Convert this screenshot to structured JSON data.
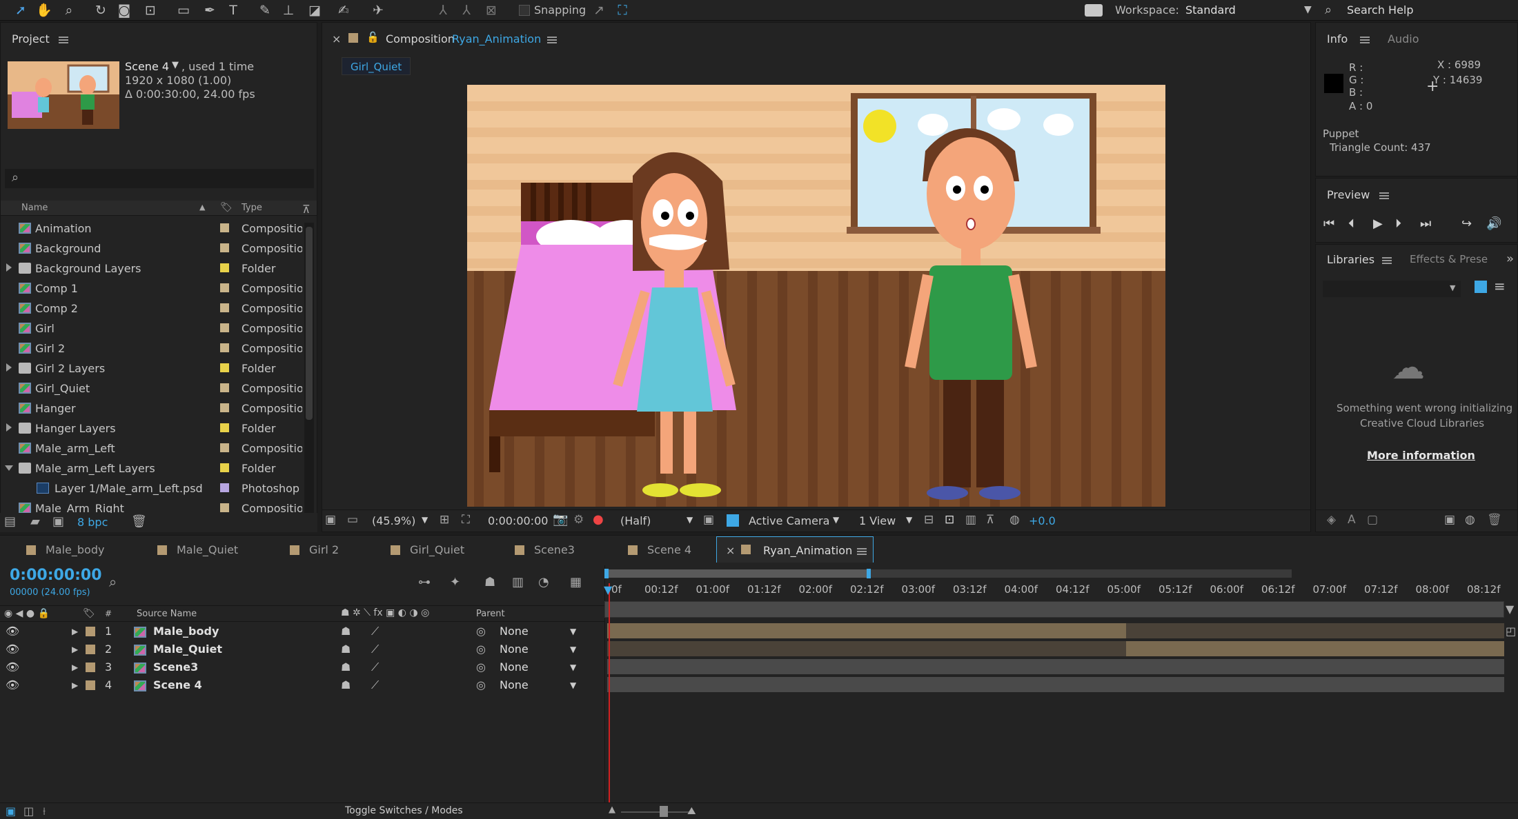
{
  "toolbar": {
    "snapping_label": "Snapping",
    "workspace_label": "Workspace:",
    "workspace_value": "Standard",
    "search_help": "Search Help"
  },
  "project": {
    "title": "Project",
    "selected_name": "Scene 4",
    "used": ", used 1 time",
    "dims": "1920 x 1080 (1.00)",
    "duration": "Δ 0:00:30:00, 24.00 fps",
    "col_name": "Name",
    "col_type": "Type",
    "items": [
      {
        "name": "Animation",
        "type": "Compositior",
        "kind": "comp",
        "label_color": "#c9b48a"
      },
      {
        "name": "Background",
        "type": "Compositior",
        "kind": "comp",
        "label_color": "#c9b48a"
      },
      {
        "name": "Background Layers",
        "type": "Folder",
        "kind": "folder",
        "label_color": "#e8d24a"
      },
      {
        "name": "Comp 1",
        "type": "Compositior",
        "kind": "comp",
        "label_color": "#c9b48a"
      },
      {
        "name": "Comp 2",
        "type": "Compositior",
        "kind": "comp",
        "label_color": "#c9b48a"
      },
      {
        "name": "Girl",
        "type": "Compositior",
        "kind": "comp",
        "label_color": "#c9b48a"
      },
      {
        "name": "Girl 2",
        "type": "Compositior",
        "kind": "comp",
        "label_color": "#c9b48a"
      },
      {
        "name": "Girl 2 Layers",
        "type": "Folder",
        "kind": "folder",
        "label_color": "#e8d24a"
      },
      {
        "name": "Girl_Quiet",
        "type": "Compositior",
        "kind": "comp",
        "label_color": "#c9b48a"
      },
      {
        "name": "Hanger",
        "type": "Compositior",
        "kind": "comp",
        "label_color": "#c9b48a"
      },
      {
        "name": "Hanger Layers",
        "type": "Folder",
        "kind": "folder",
        "label_color": "#e8d24a"
      },
      {
        "name": "Male_arm_Left",
        "type": "Compositior",
        "kind": "comp",
        "label_color": "#c9b48a"
      },
      {
        "name": "Male_arm_Left Layers",
        "type": "Folder",
        "kind": "folder",
        "label_color": "#e8d24a"
      },
      {
        "name": "Layer 1/Male_arm_Left.psd",
        "type": "Photoshop",
        "kind": "psd",
        "label_color": "#b7a6e0"
      },
      {
        "name": "Male_Arm_Right",
        "type": "Compositior",
        "kind": "comp",
        "label_color": "#c9b48a"
      }
    ],
    "bpc": "8 bpc"
  },
  "composition": {
    "panel_label": "Composition",
    "comp_name": "Ryan_Animation",
    "breadcrumb": "Girl_Quiet",
    "zoom": "(45.9%)",
    "timecode": "0:00:00:00",
    "resolution": "(Half)",
    "camera": "Active Camera",
    "views": "1 View",
    "exposure": "+0.0"
  },
  "info": {
    "tab_info": "Info",
    "tab_audio": "Audio",
    "r": "R :",
    "g": "G :",
    "b": "B :",
    "a": "A : 0",
    "x": "X : 6989",
    "y": "Y : 14639",
    "puppet": "Puppet",
    "triangle_count": "Triangle Count: 437"
  },
  "preview": {
    "title": "Preview"
  },
  "libraries": {
    "tab_libraries": "Libraries",
    "tab_effects": "Effects & Prese",
    "error_line1": "Something went wrong initializing",
    "error_line2": "Creative Cloud Libraries",
    "more_info": "More information"
  },
  "timeline": {
    "tabs": [
      "Male_body",
      "Male_Quiet",
      "Girl 2",
      "Girl_Quiet",
      "Scene3",
      "Scene 4",
      "Ryan_Animation"
    ],
    "timecode": "0:00:00:00",
    "frames": "00000 (24.00 fps)",
    "col_source": "Source Name",
    "col_parent": "Parent",
    "ruler": [
      "0f",
      "00:12f",
      "01:00f",
      "01:12f",
      "02:00f",
      "02:12f",
      "03:00f",
      "03:12f",
      "04:00f",
      "04:12f",
      "05:00f",
      "05:12f",
      "06:00f",
      "06:12f",
      "07:00f",
      "07:12f",
      "08:00f",
      "08:12f"
    ],
    "layers": [
      {
        "num": "1",
        "name": "Male_body",
        "parent": "None"
      },
      {
        "num": "2",
        "name": "Male_Quiet",
        "parent": "None"
      },
      {
        "num": "3",
        "name": "Scene3",
        "parent": "None"
      },
      {
        "num": "4",
        "name": "Scene 4",
        "parent": "None"
      }
    ],
    "toggle_label": "Toggle Switches / Modes"
  },
  "colors": {
    "accent": "#3ea8e5",
    "playhead": "#d02020",
    "label_tan": "#b49a72"
  }
}
